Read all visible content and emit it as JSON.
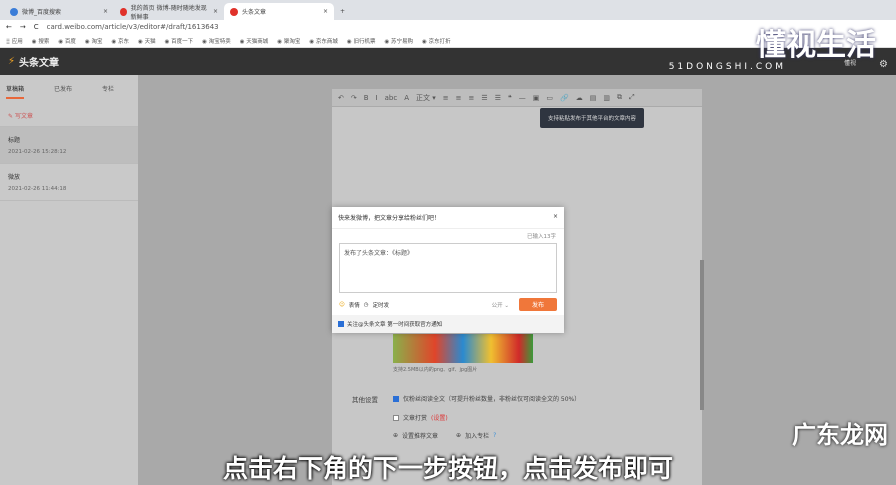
{
  "browser": {
    "tabs": [
      {
        "label": "微博_百度搜索"
      },
      {
        "label": "我的首页 微博-随时随地发现新鲜事"
      },
      {
        "label": "头条文章"
      }
    ],
    "url": "card.weibo.com/article/v3/editor#/draft/1613643",
    "bookmarks": [
      "应用",
      "搜索",
      "百度",
      "淘宝",
      "京东",
      "天猫",
      "百度一下",
      "淘宝特卖",
      "天猫商城",
      "聚淘宝",
      "京东商城",
      "旧行机票",
      "苏宁易购",
      "京东打折"
    ]
  },
  "app": {
    "title": "头条文章",
    "user": "懂视",
    "sidebar": {
      "tabs": [
        "草稿箱",
        "已发布",
        "专栏"
      ],
      "write": "写文章",
      "drafts": [
        {
          "title": "标题",
          "date": "2021-02-26 15:28:12"
        },
        {
          "title": "微放",
          "date": "2021-02-26 11:44:18"
        }
      ]
    }
  },
  "toolbar": {
    "items": [
      "↶",
      "↷",
      "B",
      "I",
      "abc",
      "A",
      "正文 ▾",
      "≡",
      "≡",
      "≡",
      "☰",
      "☰",
      "❝",
      "—",
      "▣",
      "▭",
      "🔗",
      "☁",
      "▤",
      "▥",
      "⧉",
      "⤢"
    ],
    "tooltip": "支持粘贴发布于其他平台的文章内容"
  },
  "dialog": {
    "title": "快来发微博，把文章分享给粉丝们吧！",
    "count": "已输入13字",
    "text": "发布了头条文章：《标题》",
    "emoji": "表情",
    "timer": "定时发",
    "visibility": "公开 ⌄",
    "publish": "发布",
    "follow": "关注@头条文章 第一时间获取官方通知"
  },
  "settings": {
    "image_caption": "支持2.5MB以内的png、gif、jpg图片",
    "label": "其他设置",
    "opt1": "仅粉丝阅读全文（可提升粉丝数量，非粉丝仅可阅读全文的 50%）",
    "opt2": "文章打赏",
    "opt2_link": "(设置)",
    "opt3": "设置推荐文章",
    "opt4": "加入专栏"
  },
  "overlay": {
    "subtitle": "点击右下角的下一步按钮，点击发布即可",
    "watermark": "懂视生活",
    "watermark_sub": "51DONGSHI.COM",
    "watermark2": "广东龙网"
  }
}
